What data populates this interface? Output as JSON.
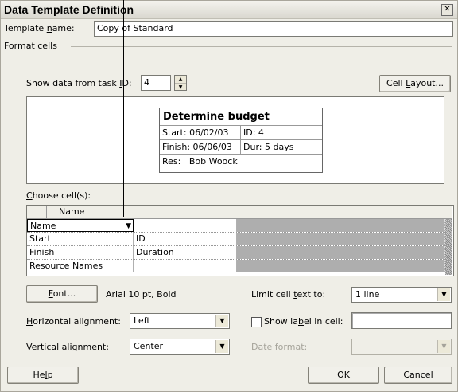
{
  "dialog": {
    "title": "Data Template Definition",
    "close_glyph": "✕"
  },
  "template_name": {
    "label_pre": "Template ",
    "label_ul": "n",
    "label_post": "ame:",
    "value": "Copy of Standard"
  },
  "format_cells": {
    "group_label": "Format cells",
    "show_data_label_pre": "Show data from task ",
    "show_data_label_ul": "I",
    "show_data_label_post": "D:",
    "task_id_value": "4",
    "cell_layout_pre": "Cell ",
    "cell_layout_ul": "L",
    "cell_layout_post": "ayout..."
  },
  "preview_card": {
    "title": "Determine budget",
    "rows": [
      {
        "left": "Start:  06/02/03",
        "right": "ID:  4"
      },
      {
        "left": "Finish: 06/06/03",
        "right": "Dur: 5 days"
      },
      {
        "left": "Res:   Bob Woock",
        "right": ""
      }
    ]
  },
  "choose_cells": {
    "label_pre": "",
    "label_ul": "C",
    "label_post": "hoose cell(s):",
    "column_header": "Name",
    "rows": [
      [
        "Name",
        ""
      ],
      [
        "Start",
        "ID"
      ],
      [
        "Finish",
        "Duration"
      ],
      [
        "Resource Names",
        ""
      ]
    ]
  },
  "font": {
    "button_pre": "",
    "button_ul": "F",
    "button_post": "ont...",
    "value": "Arial 10 pt, Bold"
  },
  "limit_text": {
    "label_pre": "Limit cell ",
    "label_ul": "t",
    "label_post": "ext to:",
    "value": "1 line"
  },
  "horizontal": {
    "label_pre": "",
    "label_ul": "H",
    "label_post": "orizontal alignment:",
    "value": "Left"
  },
  "show_label": {
    "label_pre": "Show la",
    "label_ul": "b",
    "label_post": "el in cell:",
    "value": ""
  },
  "vertical": {
    "label_pre": "",
    "label_ul": "V",
    "label_post": "ertical alignment:",
    "value": "Center"
  },
  "date_format": {
    "label_pre": "",
    "label_ul": "D",
    "label_post": "ate format:",
    "value": ""
  },
  "buttons": {
    "help_pre": "He",
    "help_ul": "l",
    "help_post": "p",
    "ok": "OK",
    "cancel": "Cancel"
  },
  "icons": {
    "dropdown": "▼",
    "spin_up": "▲",
    "spin_down": "▼"
  }
}
